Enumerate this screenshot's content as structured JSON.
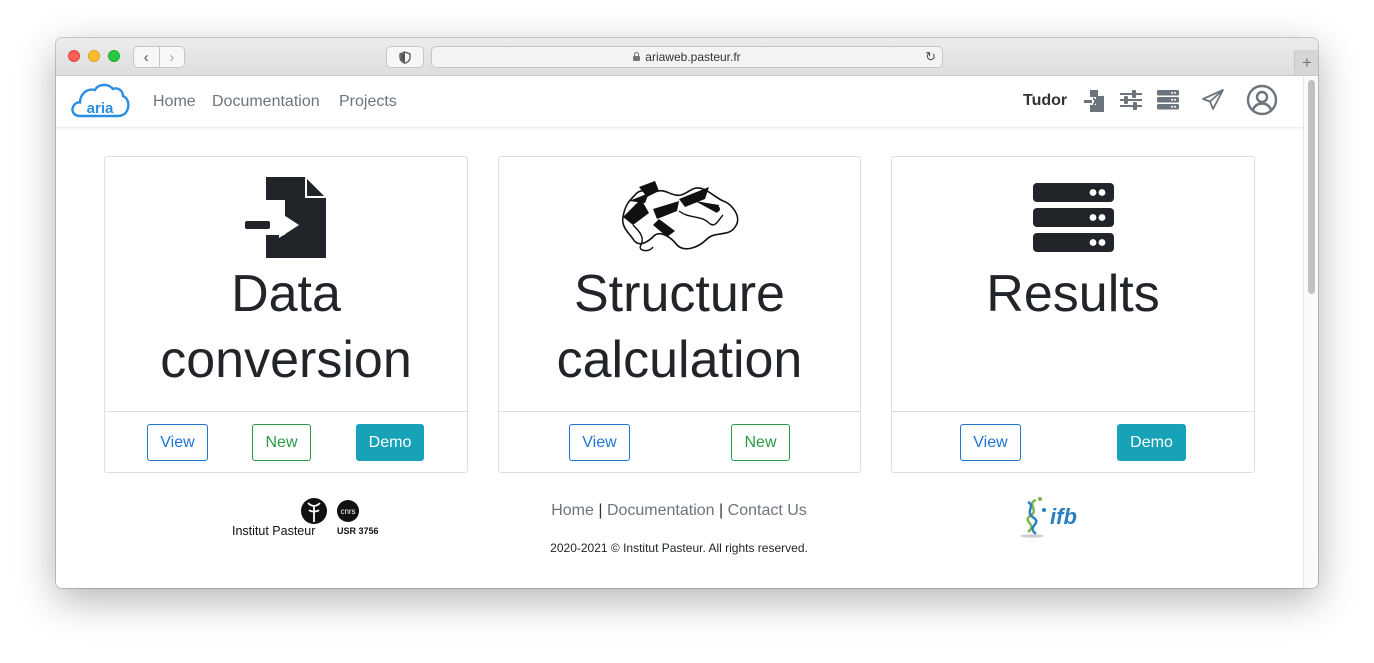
{
  "browser": {
    "url": "ariaweb.pasteur.fr"
  },
  "navbar": {
    "logo_text": "aria",
    "links": [
      "Home",
      "Documentation",
      "Projects"
    ],
    "user": "Tudor",
    "icons": [
      "file-import-icon",
      "sliders-icon",
      "server-icon",
      "paper-plane-icon",
      "user-circle-icon"
    ]
  },
  "cards": [
    {
      "title_line1": "Data",
      "title_line2": "conversion",
      "icon": "file-import-icon",
      "buttons": {
        "view": "View",
        "new": "New",
        "demo": "Demo"
      }
    },
    {
      "title_line1": "Structure",
      "title_line2": "calculation",
      "icon": "protein-structure-icon",
      "buttons": {
        "view": "View",
        "new": "New"
      }
    },
    {
      "title_line1": "Results",
      "icon": "server-icon",
      "buttons": {
        "view": "View",
        "demo": "Demo"
      }
    }
  ],
  "footer": {
    "links": [
      "Home",
      "Documentation",
      "Contact Us"
    ],
    "separator": "|",
    "copyright": "2020-2021 © Institut Pasteur. All rights reserved.",
    "logos": {
      "pasteur": "Institut Pasteur",
      "cnrs": "cnrs",
      "usr": "USR 3756",
      "ifb": "ifb"
    }
  },
  "colors": {
    "primary": "#1f74d4",
    "success": "#2a9a45",
    "info": "#17a2b8",
    "text_dark": "#212529",
    "nav_link": "#6c757d"
  }
}
